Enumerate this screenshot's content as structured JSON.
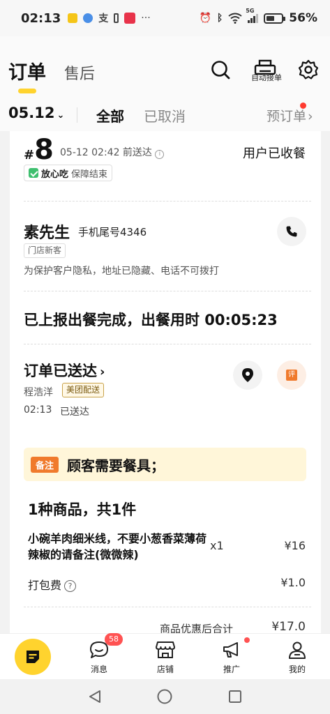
{
  "status_bar": {
    "time": "02:13",
    "battery_percent": "56%",
    "battery_level": 0.56,
    "network": "5G"
  },
  "header": {
    "tab_orders": "订单",
    "tab_after_sales": "售后",
    "print_label": "自动接单"
  },
  "filter": {
    "date": "05.12",
    "all": "全部",
    "cancelled": "已取消",
    "preorder": "预订单"
  },
  "order": {
    "hash": "#",
    "number": "8",
    "deliver_before": "05-12 02:42 前送达",
    "status": "用户已收餐",
    "safe_title": "放心吃",
    "safe_sub": "保障结束",
    "customer_name": "素先生",
    "customer_phone": "手机尾号4346",
    "new_customer_tag": "门店新客",
    "privacy_note": "为保护客户隐私，地址已隐藏、电话不可拨打",
    "meal_done": "已上报出餐完成，出餐用时 00:05:23",
    "delivered_title": "订单已送达",
    "courier_name": "程浩洋",
    "courier_tag": "美团配送",
    "delivered_time": "02:13",
    "delivered_label": "已送达",
    "review_icon_text": "评",
    "remark_tag": "备注",
    "remark_text": "顾客需要餐具；",
    "goods_count": "1种商品，共1件",
    "item_name": "小碗羊肉细米线，不要小葱香菜薄荷辣椒的请备注(微微辣)",
    "item_qty": "x1",
    "item_price": "¥16",
    "pack_label": "打包费",
    "pack_price": "¥1.0",
    "cut_label": "商品优惠后合计",
    "cut_value": "¥17.0"
  },
  "bottom_nav": {
    "messages": "消息",
    "messages_badge": "58",
    "store": "店铺",
    "promote": "推广",
    "mine": "我的"
  }
}
